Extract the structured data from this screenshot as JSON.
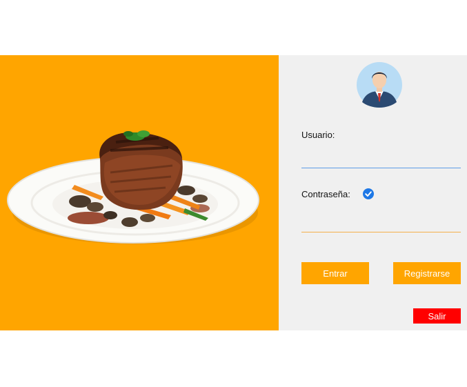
{
  "hero": {
    "image": "steak-plate-image",
    "background_color": "#FFA500"
  },
  "login": {
    "avatar_icon": "user-avatar-icon",
    "username_label": "Usuario:",
    "username_value": "",
    "password_label": "Contraseña:",
    "password_value": "",
    "show_password_checked": true,
    "login_button": "Entrar",
    "register_button": "Registrarse",
    "exit_button": "Salir",
    "accent_color": "#FFA500",
    "exit_color": "#FF0000"
  }
}
